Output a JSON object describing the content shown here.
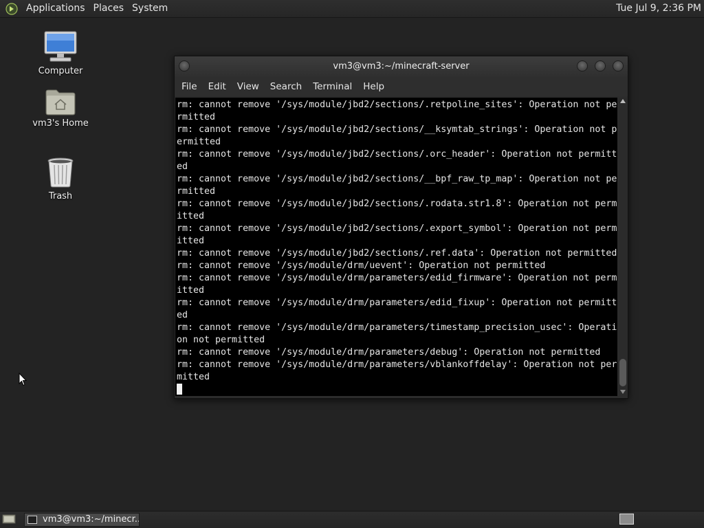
{
  "top_panel": {
    "logo_icon": "distro-logo-icon",
    "menus": [
      "Applications",
      "Places",
      "System"
    ],
    "clock": "Tue Jul  9,  2:36 PM"
  },
  "desktop_icons": [
    {
      "label": "Computer",
      "icon": "computer-icon"
    },
    {
      "label": "vm3's Home",
      "icon": "home-folder-icon"
    },
    {
      "label": "Trash",
      "icon": "trash-icon"
    }
  ],
  "terminal": {
    "title": "vm3@vm3:~/minecraft-server",
    "menu": [
      "File",
      "Edit",
      "View",
      "Search",
      "Terminal",
      "Help"
    ],
    "lines": [
      "rm: cannot remove '/sys/module/jbd2/sections/.retpoline_sites': Operation not pe",
      "rmitted",
      "rm: cannot remove '/sys/module/jbd2/sections/__ksymtab_strings': Operation not p",
      "ermitted",
      "rm: cannot remove '/sys/module/jbd2/sections/.orc_header': Operation not permitt",
      "ed",
      "rm: cannot remove '/sys/module/jbd2/sections/__bpf_raw_tp_map': Operation not pe",
      "rmitted",
      "rm: cannot remove '/sys/module/jbd2/sections/.rodata.str1.8': Operation not perm",
      "itted",
      "rm: cannot remove '/sys/module/jbd2/sections/.export_symbol': Operation not perm",
      "itted",
      "rm: cannot remove '/sys/module/jbd2/sections/.ref.data': Operation not permitted",
      "rm: cannot remove '/sys/module/drm/uevent': Operation not permitted",
      "rm: cannot remove '/sys/module/drm/parameters/edid_firmware': Operation not perm",
      "itted",
      "rm: cannot remove '/sys/module/drm/parameters/edid_fixup': Operation not permitt",
      "ed",
      "rm: cannot remove '/sys/module/drm/parameters/timestamp_precision_usec': Operati",
      "on not permitted",
      "rm: cannot remove '/sys/module/drm/parameters/debug': Operation not permitted",
      "rm: cannot remove '/sys/module/drm/parameters/vblankoffdelay': Operation not per",
      "mitted"
    ]
  },
  "taskbar": {
    "task_label": "vm3@vm3:~/minecr...",
    "task_icon": "terminal-icon",
    "show_desktop_icon": "show-desktop-icon",
    "workspace_icon": "workspace-switcher-icon"
  },
  "colors": {
    "desktop_bg": "#232323",
    "panel_bg": "#2a2a2a",
    "terminal_bg": "#000000",
    "terminal_fg": "#e6e6e6"
  }
}
